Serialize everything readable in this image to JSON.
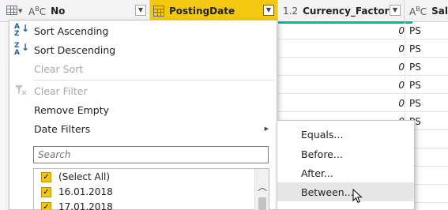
{
  "header": {
    "col_no": {
      "type": "ABC",
      "name": "No"
    },
    "col_posting": {
      "name": "PostingDate"
    },
    "col_currency": {
      "type": "1.2",
      "name": "Currency_Factor"
    },
    "col_sales": {
      "type": "ABC",
      "name": "Salesp"
    }
  },
  "rows": [
    {
      "currency": "0",
      "sales": "PS"
    },
    {
      "currency": "0",
      "sales": "PS"
    },
    {
      "currency": "0",
      "sales": "PS"
    },
    {
      "currency": "0",
      "sales": "PS"
    },
    {
      "currency": "0",
      "sales": "PS"
    },
    {
      "currency": "0",
      "sales": "PS"
    }
  ],
  "menu": {
    "sort_asc": "Sort Ascending",
    "sort_desc": "Sort Descending",
    "clear_sort": "Clear Sort",
    "clear_filter": "Clear Filter",
    "remove_empty": "Remove Empty",
    "date_filters": "Date Filters",
    "search_placeholder": "Search",
    "list": [
      {
        "label": "(Select All)",
        "checked": true
      },
      {
        "label": "16.01.2018",
        "checked": true
      },
      {
        "label": "17.01.2018",
        "checked": true
      }
    ]
  },
  "submenu": {
    "equals": "Equals...",
    "before": "Before...",
    "after": "After...",
    "between": "Between..."
  },
  "colors": {
    "selected_header": "#f2c811",
    "accent": "#01b8aa",
    "checkbox": "#f2c811"
  }
}
